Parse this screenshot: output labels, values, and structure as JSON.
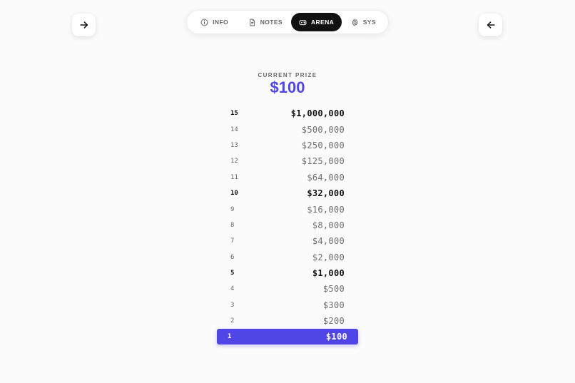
{
  "nav": {
    "forward_icon": "arrow-right-icon",
    "back_icon": "arrow-left-icon"
  },
  "tabs": [
    {
      "label": "INFO",
      "icon": "info-icon",
      "active": false
    },
    {
      "label": "NOTES",
      "icon": "document-icon",
      "active": false
    },
    {
      "label": "ARENA",
      "icon": "gamepad-icon",
      "active": true
    },
    {
      "label": "SYS",
      "icon": "gear-icon",
      "active": false
    }
  ],
  "prize": {
    "label": "CURRENT PRIZE",
    "value": "$100",
    "accent_color": "#4f46e5"
  },
  "ladder": [
    {
      "level": "15",
      "amount": "$1,000,000",
      "milestone": true,
      "current": false
    },
    {
      "level": "14",
      "amount": "$500,000",
      "milestone": false,
      "current": false
    },
    {
      "level": "13",
      "amount": "$250,000",
      "milestone": false,
      "current": false
    },
    {
      "level": "12",
      "amount": "$125,000",
      "milestone": false,
      "current": false
    },
    {
      "level": "11",
      "amount": "$64,000",
      "milestone": false,
      "current": false
    },
    {
      "level": "10",
      "amount": "$32,000",
      "milestone": true,
      "current": false
    },
    {
      "level": "9",
      "amount": "$16,000",
      "milestone": false,
      "current": false
    },
    {
      "level": "8",
      "amount": "$8,000",
      "milestone": false,
      "current": false
    },
    {
      "level": "7",
      "amount": "$4,000",
      "milestone": false,
      "current": false
    },
    {
      "level": "6",
      "amount": "$2,000",
      "milestone": false,
      "current": false
    },
    {
      "level": "5",
      "amount": "$1,000",
      "milestone": true,
      "current": false
    },
    {
      "level": "4",
      "amount": "$500",
      "milestone": false,
      "current": false
    },
    {
      "level": "3",
      "amount": "$300",
      "milestone": false,
      "current": false
    },
    {
      "level": "2",
      "amount": "$200",
      "milestone": false,
      "current": false
    },
    {
      "level": "1",
      "amount": "$100",
      "milestone": false,
      "current": true
    }
  ]
}
